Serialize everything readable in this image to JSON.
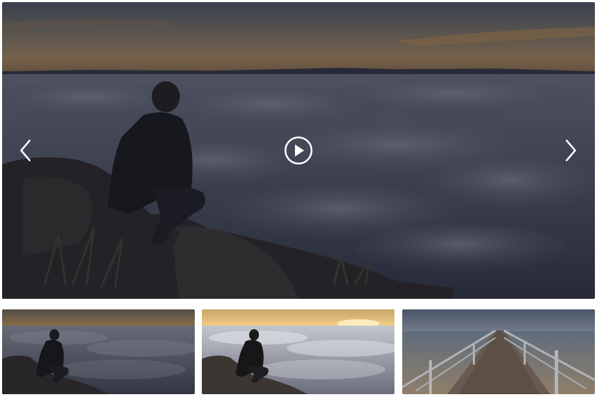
{
  "gallery": {
    "main": {
      "image": "man-sitting-on-rock-above-sea-of-clouds",
      "prev_icon": "chevron-left-icon",
      "next_icon": "chevron-right-icon",
      "play_icon": "play-circle-icon"
    },
    "thumbnails": [
      {
        "image": "man-on-rock-above-clouds-dusk"
      },
      {
        "image": "man-on-rock-above-clouds-sunrise"
      },
      {
        "image": "wooden-pier-over-sea"
      }
    ],
    "colors": {
      "overlay": "#1b1e2b",
      "sky_top": "#2f3a48",
      "sky_glow": "#c59a52",
      "clouds": "#6d7180",
      "rock": "#2b2826"
    }
  }
}
